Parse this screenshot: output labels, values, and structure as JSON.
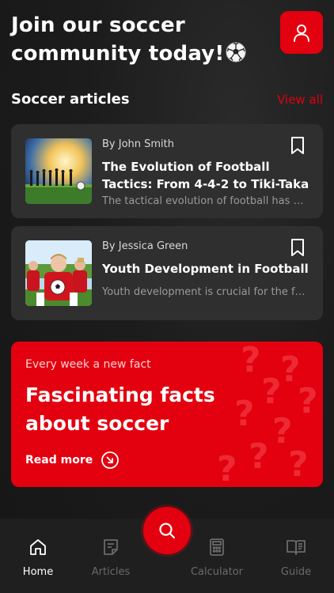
{
  "header": {
    "title_line1": "Join our soccer",
    "title_line2": "community today!"
  },
  "icons": {
    "profile": "user-icon",
    "soccer_ball": "soccer-ball-icon",
    "bookmark": "bookmark-icon",
    "search": "search-icon",
    "arrow": "arrow-circle-icon"
  },
  "colors": {
    "accent": "#e3000f",
    "card_bg": "#2f2f2f",
    "background": "#1c1c1c"
  },
  "articles_section": {
    "title": "Soccer articles",
    "view_all": "View all"
  },
  "articles": [
    {
      "author": "By John Smith",
      "title": "The Evolution of Football Tactics: From 4-4-2 to Tiki-Taka",
      "excerpt": "The tactical evolution of football has transformed the game"
    },
    {
      "author": "By Jessica Green",
      "title": "Youth Development in Football",
      "excerpt": "Youth development is crucial for the future of the sport"
    }
  ],
  "promo": {
    "kicker": "Every week a new fact",
    "title": "Fascinating facts about soccer",
    "cta": "Read more"
  },
  "nav": {
    "home": "Home",
    "articles": "Articles",
    "calculator": "Calculator",
    "guide": "Guide"
  }
}
